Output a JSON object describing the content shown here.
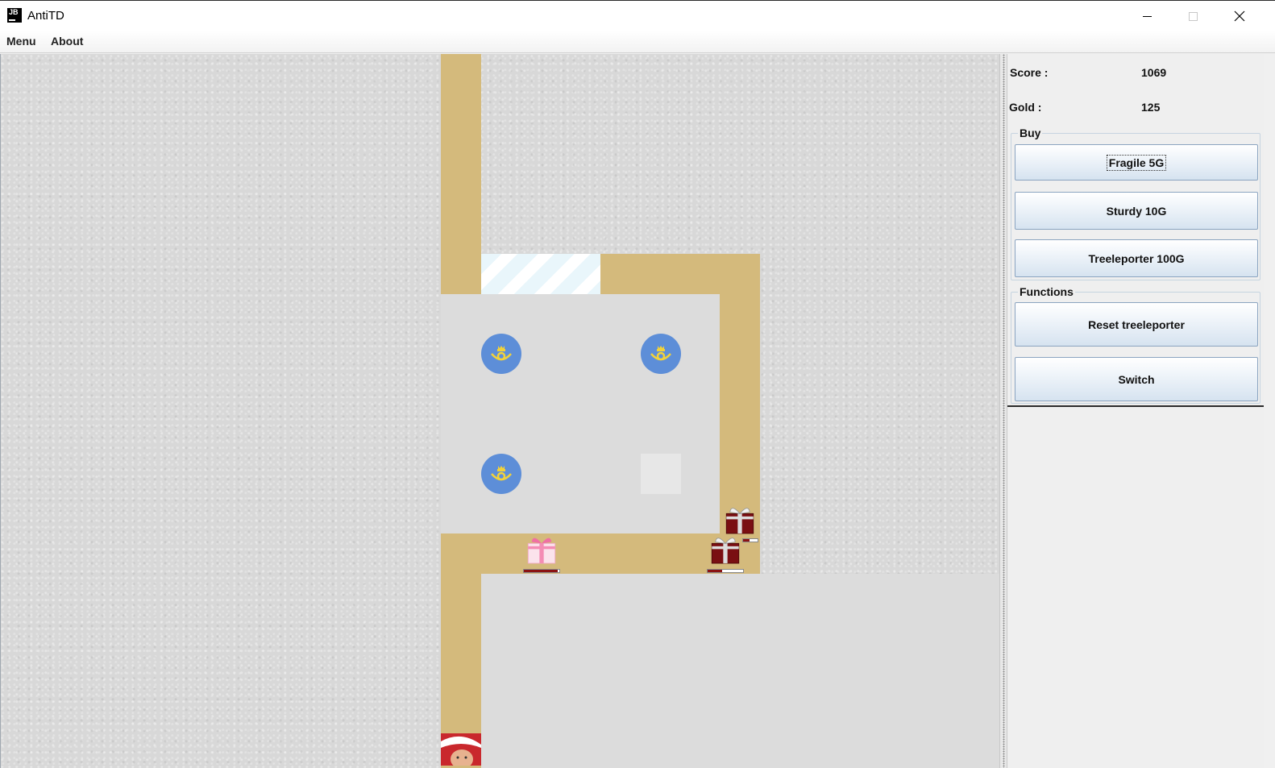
{
  "window": {
    "title": "AntiTD",
    "app_icon": "jb-icon"
  },
  "menubar": {
    "items": [
      {
        "label": "Menu"
      },
      {
        "label": "About"
      }
    ]
  },
  "stats": {
    "score_label": "Score :",
    "score_value": "1069",
    "gold_label": "Gold  :",
    "gold_value": "125"
  },
  "buy": {
    "title": "Buy",
    "buttons": [
      {
        "label": "Fragile 5G",
        "focused": true
      },
      {
        "label": "Sturdy 10G"
      },
      {
        "label": "Treeleporter 100G"
      }
    ]
  },
  "functions": {
    "title": "Functions",
    "buttons": [
      {
        "label": "Reset treeleporter"
      },
      {
        "label": "Switch"
      }
    ]
  },
  "board": {
    "path_color": "#d4ba7c",
    "tower_color": "#5d8ed8",
    "towers": [
      "posthorn-tower-icon",
      "posthorn-tower-icon",
      "posthorn-tower-icon"
    ],
    "units": [
      {
        "type": "gift-pink-icon",
        "health": 0.95
      },
      {
        "type": "gift-red-icon",
        "health": 0.45
      },
      {
        "type": "gift-red-icon",
        "health": 0.4
      }
    ],
    "goal": "santa-baby-icon"
  }
}
